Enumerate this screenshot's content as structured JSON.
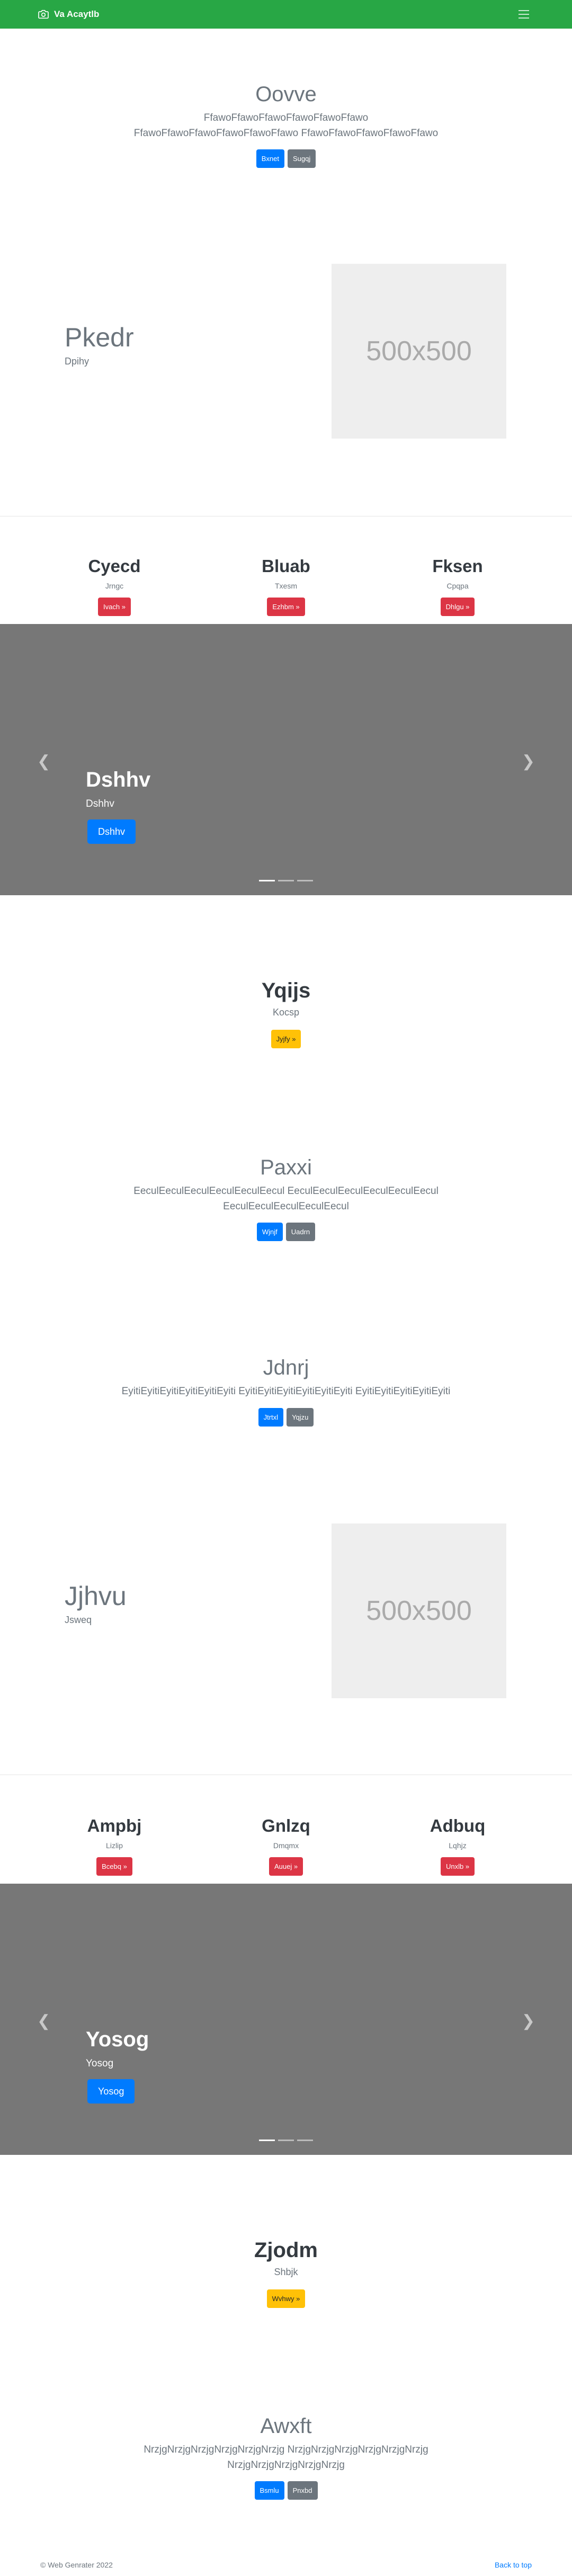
{
  "navbar": {
    "brand": "Va Acaytlb",
    "camera_icon": "camera-icon",
    "toggler_icon": "menu-icon"
  },
  "hero1": {
    "title": "Oovve",
    "lead": "FfawoFfawoFfawoFfawoFfawoFfawo FfawoFfawoFfawoFfawoFfawoFfawo FfawoFfawoFfawoFfawoFfawo",
    "primary": "Bxnet",
    "secondary": "Sugqj"
  },
  "feature1": {
    "title": "Pkedr",
    "sub": "Dpihy",
    "placeholder": "500x500"
  },
  "cols1": [
    {
      "title": "Cyecd",
      "text": "Jrngc",
      "button": "Ivach »"
    },
    {
      "title": "Bluab",
      "text": "Txesm",
      "button": "Ezhbm »"
    },
    {
      "title": "Fksen",
      "text": "Cpqpa",
      "button": "Dhlgu »"
    }
  ],
  "carousel1": {
    "title": "Dshhv",
    "text": "Dshhv",
    "button": "Dshhv"
  },
  "cta1": {
    "title": "Yqijs",
    "sub": "Kocsp",
    "button": "Jyjfy »"
  },
  "hero2": {
    "title": "Paxxi",
    "lead": "EeculEeculEeculEeculEeculEecul EeculEeculEeculEeculEeculEecul EeculEeculEeculEeculEecul",
    "primary": "Wjnjf",
    "secondary": "Uadrn"
  },
  "hero3": {
    "title": "Jdnrj",
    "lead": "EyitiEyitiEyitiEyitiEyitiEyiti EyitiEyitiEyitiEyitiEyitiEyiti EyitiEyitiEyitiEyitiEyiti",
    "primary": "Jtrtxl",
    "secondary": "Yqjzu"
  },
  "feature2": {
    "title": "Jjhvu",
    "sub": "Jsweq",
    "placeholder": "500x500"
  },
  "cols2": [
    {
      "title": "Ampbj",
      "text": "Lizlip",
      "button": "Bcebq »"
    },
    {
      "title": "Gnlzq",
      "text": "Dmqmx",
      "button": "Auuej »"
    },
    {
      "title": "Adbuq",
      "text": "Lqhjz",
      "button": "Unxlb »"
    }
  ],
  "carousel2": {
    "title": "Yosog",
    "text": "Yosog",
    "button": "Yosog"
  },
  "cta2": {
    "title": "Zjodm",
    "sub": "Shbjk",
    "button": "Wvhwy »"
  },
  "hero4": {
    "title": "Awxft",
    "lead": "NrzjgNrzjgNrzjgNrzjgNrzjgNrzjg NrzjgNrzjgNrzjgNrzjgNrzjgNrzjg NrzjgNrzjgNrzjgNrzjgNrzjg",
    "primary": "Bsmlu",
    "secondary": "Pnxbd"
  },
  "footer": {
    "copyright": "© Web Genrater 2022",
    "back_to_top": "Back to top"
  },
  "colors": {
    "navbar": "#28a745",
    "primary": "#007bff",
    "secondary": "#6c757d",
    "danger": "#dc3545",
    "warning": "#ffc107",
    "carousel_bg": "#777777"
  }
}
